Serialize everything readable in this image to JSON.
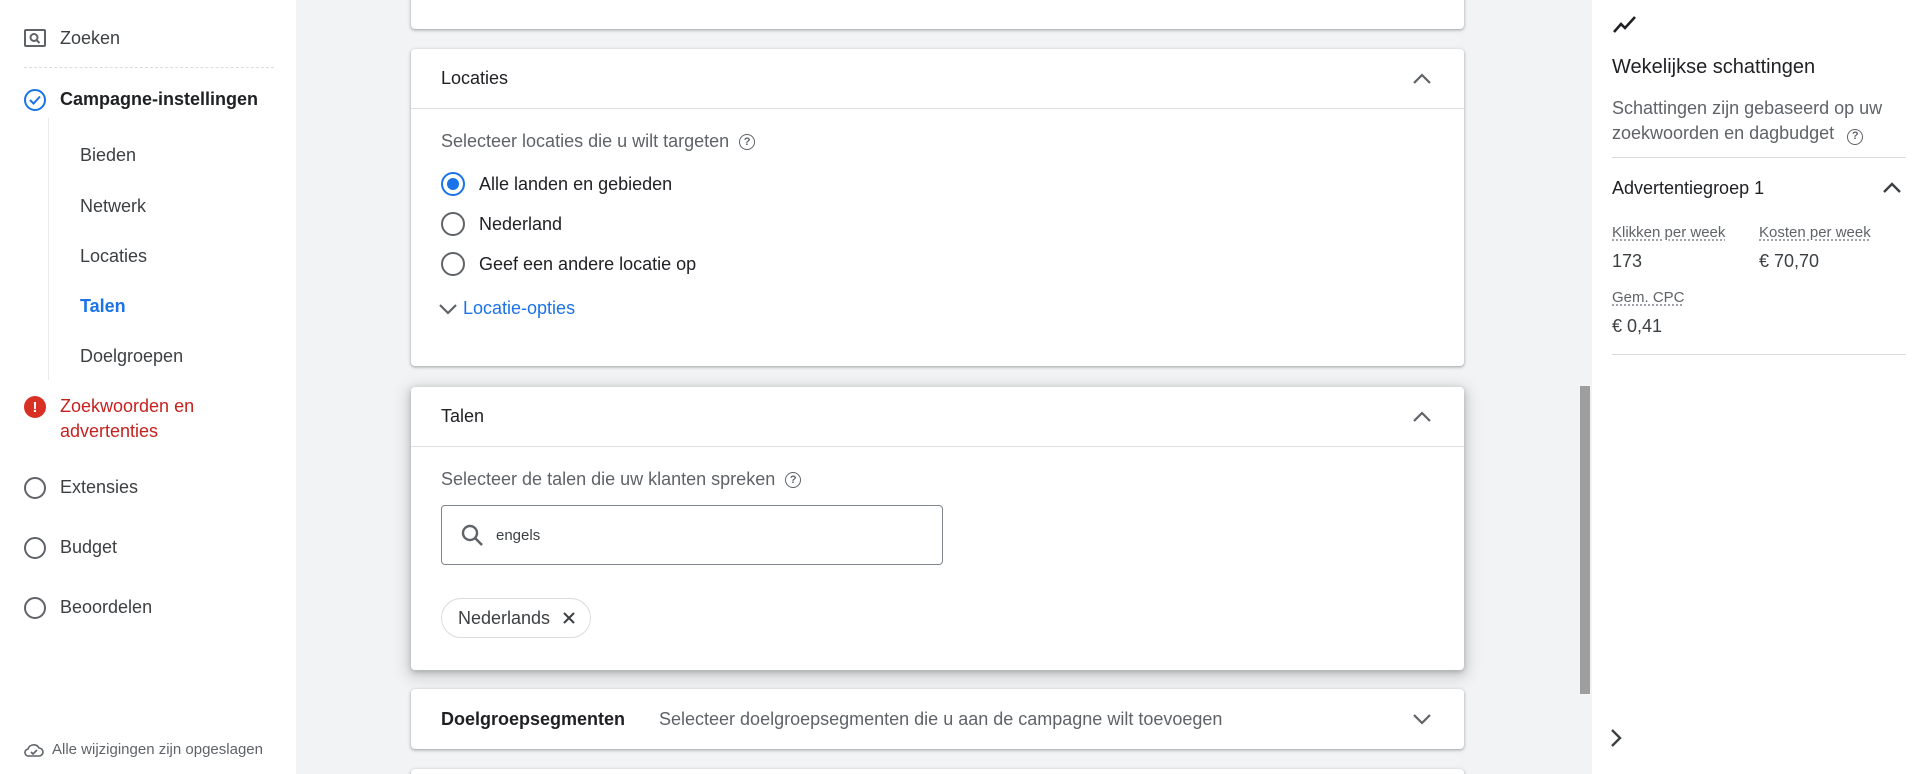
{
  "nav": {
    "search_label": "Zoeken",
    "campaign_settings": "Campagne-instellingen",
    "sub_items": [
      "Bieden",
      "Netwerk",
      "Locaties",
      "Talen",
      "Doelgroepen"
    ],
    "keywords_ads": "Zoekwoorden en advertenties",
    "extensions": "Extensies",
    "budget": "Budget",
    "review": "Beoordelen",
    "saved_status": "Alle wijzigingen zijn opgeslagen"
  },
  "locations": {
    "title": "Locaties",
    "question": "Selecteer locaties die u wilt targeten",
    "options": [
      "Alle landen en gebieden",
      "Nederland",
      "Geef een andere locatie op"
    ],
    "selected_index": 0,
    "more_options": "Locatie-opties"
  },
  "languages": {
    "title": "Talen",
    "question": "Selecteer de talen die uw klanten spreken",
    "search_value": "engels",
    "chips": [
      "Nederlands"
    ]
  },
  "audience": {
    "title": "Doelgroepsegmenten",
    "description": "Selecteer doelgroepsegmenten die u aan de campagne wilt toevoegen"
  },
  "estimates": {
    "title": "Wekelijkse schattingen",
    "description": "Schattingen zijn gebaseerd op uw zoekwoorden en dagbudget",
    "group_name": "Advertentiegroep 1",
    "clicks_label": "Klikken per week",
    "clicks_value": "173",
    "cost_label": "Kosten per week",
    "cost_value": "€ 70,70",
    "cpc_label": "Gem. CPC",
    "cpc_value": "€ 0,41"
  },
  "colors": {
    "accent": "#1a73e8",
    "error": "#d93025"
  }
}
